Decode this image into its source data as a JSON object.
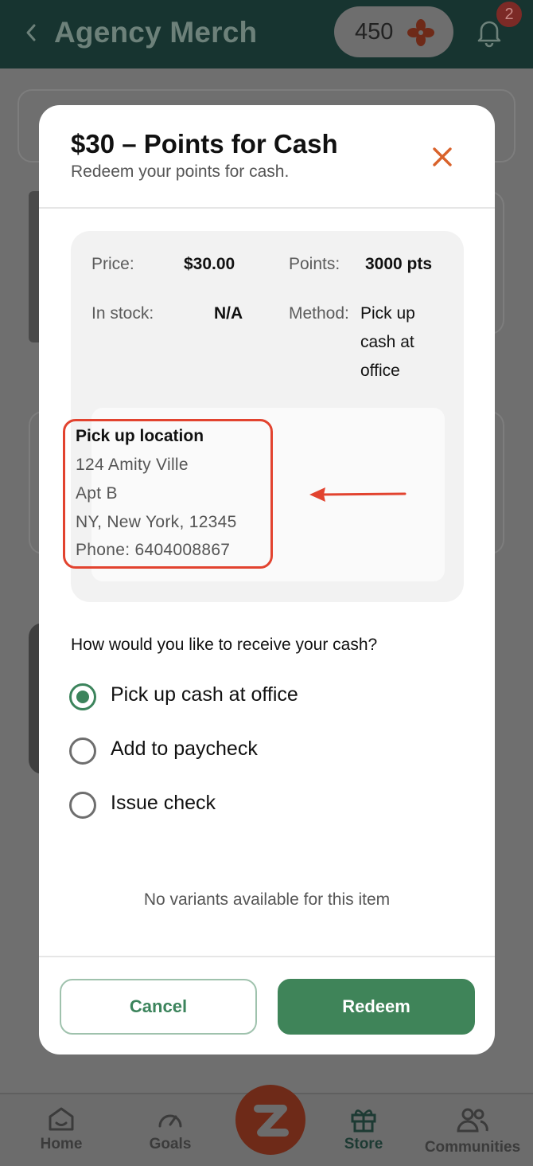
{
  "header": {
    "title": "Agency Merch",
    "points": "450",
    "notification_count": "2"
  },
  "modal": {
    "title": "$30 – Points for Cash",
    "subtitle": "Redeem your points for cash.",
    "details": {
      "price_label": "Price:",
      "price_value": "$30.00",
      "points_label": "Points:",
      "points_value": "3000 pts",
      "stock_label": "In stock:",
      "stock_value": "N/A",
      "method_label": "Method:",
      "method_value": "Pick up cash at office"
    },
    "pickup": {
      "title": "Pick up location",
      "line1": "124 Amity Ville",
      "line2": "Apt B",
      "line3": "NY, New York, 12345",
      "line4": "Phone: 6404008867"
    },
    "question": "How would you like to receive your cash?",
    "options": [
      {
        "label": "Pick up cash at office",
        "selected": true
      },
      {
        "label": "Add to paycheck",
        "selected": false
      },
      {
        "label": "Issue check",
        "selected": false
      }
    ],
    "no_variants": "No variants available for this item",
    "cancel_label": "Cancel",
    "redeem_label": "Redeem"
  },
  "nav": {
    "home": "Home",
    "goals": "Goals",
    "store": "Store",
    "communities": "Communities"
  },
  "colors": {
    "accent_green": "#3f8459",
    "close_orange": "#d9622b",
    "highlight_red": "#e2432f",
    "header_bg": "#173430"
  }
}
